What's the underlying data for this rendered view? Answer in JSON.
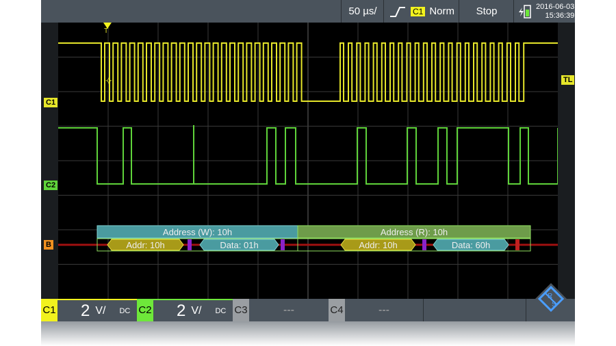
{
  "topbar": {
    "timebase": "50 µs/",
    "trigger_source": "C1",
    "trigger_mode": "Norm",
    "run_state": "Stop",
    "date": "2016-06-03",
    "time": "15:36:39",
    "icons": [
      "trigger-rising-edge-icon",
      "battery-charging-icon"
    ]
  },
  "markers": {
    "c1": "C1",
    "c2": "C2",
    "bus": "B",
    "trigger_level": "TL",
    "trigger_pos": "T"
  },
  "bus_decode": {
    "frames": [
      {
        "label": "Address (W): 10h",
        "addr": "Addr: 10h",
        "data": "Data: 01h"
      },
      {
        "label": "Address (R): 10h",
        "addr": "Addr: 10h",
        "data": "Data: 60h"
      }
    ]
  },
  "channels": [
    {
      "name": "C1",
      "scale": "2",
      "unit": "V/",
      "coupling": "DC",
      "color": "#f2f21e"
    },
    {
      "name": "C2",
      "scale": "2",
      "unit": "V/",
      "coupling": "DC",
      "color": "#6ee83a"
    },
    {
      "name": "C3",
      "value": "---"
    },
    {
      "name": "C4",
      "value": "---"
    }
  ],
  "colors": {
    "c1": "#e6e62a",
    "c2": "#5fd33a",
    "bus": "#f09020",
    "bus_line": "#a01010"
  }
}
